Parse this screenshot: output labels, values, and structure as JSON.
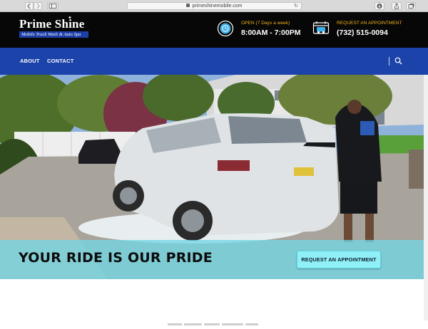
{
  "browser": {
    "url": "primeshinemobile.com",
    "back_icon": "chevron-left-icon",
    "forward_icon": "chevron-right-icon",
    "sidebar_icon": "sidebar-icon",
    "reload_icon": "reload-icon",
    "download_icon": "download-icon",
    "share_icon": "share-icon",
    "tabs_icon": "tabs-icon"
  },
  "header": {
    "logo_title": "Prime Shine",
    "logo_subtitle": "Mobile Truck Wash & Auto Spa",
    "hours": {
      "label": "OPEN (7 Days a week)",
      "value": "8:00AM - 7:00PM",
      "icon": "clock-icon"
    },
    "appointment": {
      "label": "REQUEST AN APPOINTMENT",
      "value": "(732) 515-0094",
      "icon": "truck-icon"
    }
  },
  "nav": {
    "items": [
      {
        "label": "ABOUT"
      },
      {
        "label": "CONTACT"
      }
    ],
    "search_icon": "search-icon"
  },
  "hero": {
    "title": "YOUR RIDE IS OUR PRIDE",
    "cta_label": "REQUEST AN APPOINTMENT"
  },
  "colors": {
    "header_bg": "#070707",
    "nav_bg": "#1b43a9",
    "accent": "#f2b01e",
    "band": "#72d6e4",
    "cta": "#8ff0f8"
  }
}
